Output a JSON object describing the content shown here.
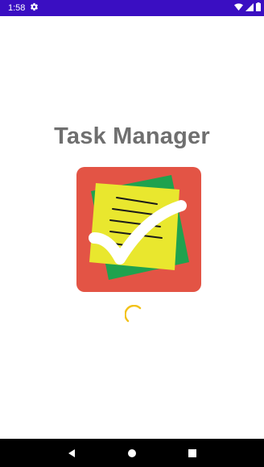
{
  "status_bar": {
    "time": "1:58",
    "icons": [
      "settings-gear-icon",
      "wifi-icon",
      "signal-icon",
      "battery-icon"
    ],
    "background": "#3a0ec2"
  },
  "app": {
    "title": "Task Manager",
    "title_color": "#6f6f6f"
  },
  "logo": {
    "icon": "task-checklist-logo",
    "colors": {
      "background": "#e35445",
      "back_sheet": "#1fa24e",
      "note": "#e9e72e",
      "checkmark": "#ffffff"
    }
  },
  "loading": {
    "indicator": "circular-spinner",
    "color": "#f2c21b"
  },
  "nav_bar": {
    "buttons": [
      "back-icon",
      "home-icon",
      "recents-icon"
    ]
  }
}
